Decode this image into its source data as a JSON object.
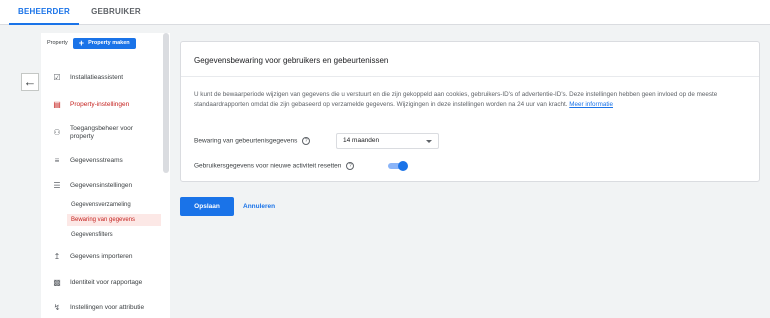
{
  "tabs": {
    "admin": "BEHEERDER",
    "user": "GEBRUIKER"
  },
  "nav": {
    "property_label": "Property",
    "create_property": "Property maken",
    "items": [
      {
        "label": "Installatieassistent",
        "icon": "checklist-icon"
      },
      {
        "label": "Property-instellingen",
        "icon": "property-settings-icon"
      },
      {
        "label_1": "Toegangsbeheer voor",
        "label_2": "property",
        "icon": "people-icon"
      },
      {
        "label": "Gegevensstreams",
        "icon": "streams-icon"
      },
      {
        "label": "Gegevensinstellingen",
        "icon": "database-icon"
      },
      {
        "label": "Gegevens importeren",
        "icon": "upload-icon"
      },
      {
        "label": "Identiteit voor rapportage",
        "icon": "identity-icon"
      },
      {
        "label": "Instellingen voor attributie",
        "icon": "attribution-icon"
      }
    ],
    "sub_items": [
      "Gegevensverzameling",
      "Bewaring van gegevens",
      "Gegevensfilters"
    ]
  },
  "card": {
    "title": "Gegevensbewaring voor gebruikers en gebeurtenissen",
    "description": "U kunt de bewaarperiode wijzigen van gegevens die u verstuurt en die zijn gekoppeld aan cookies, gebruikers-ID's of advertentie-ID's. Deze instellingen hebben geen invloed op de meeste standaardrapporten omdat die zijn gebaseerd op verzamelde gegevens. Wijzigingen in deze instellingen worden na 24 uur van kracht.",
    "more_info": "Meer informatie",
    "retention_label": "Bewaring van gebeurtenisgegevens",
    "retention_value": "14 maanden",
    "reset_label": "Gebruikersgegevens voor nieuwe activiteit resetten",
    "reset_enabled": true
  },
  "actions": {
    "save": "Opslaan",
    "cancel": "Annuleren"
  },
  "colors": {
    "accent": "#1a73e8",
    "active_nav": "#c5221f",
    "active_bg": "#fce8e6"
  }
}
